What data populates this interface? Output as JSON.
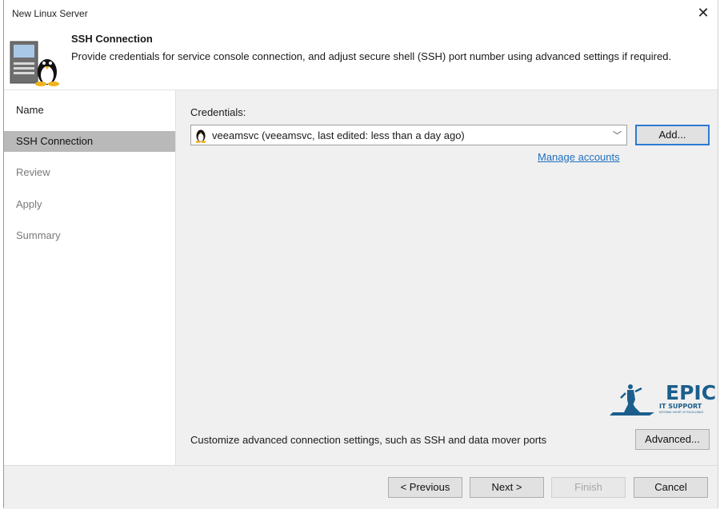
{
  "window": {
    "title": "New Linux Server"
  },
  "header": {
    "title": "SSH Connection",
    "description": "Provide credentials for service console connection, and adjust secure shell (SSH) port number using advanced settings if required."
  },
  "steps": [
    {
      "label": "Name",
      "state": "done"
    },
    {
      "label": "SSH Connection",
      "state": "active"
    },
    {
      "label": "Review",
      "state": "future"
    },
    {
      "label": "Apply",
      "state": "future"
    },
    {
      "label": "Summary",
      "state": "future"
    }
  ],
  "credentials": {
    "label": "Credentials:",
    "selected": "veeamsvc (veeamsvc, last edited: less than a day ago)",
    "add_label": "Add...",
    "manage_link": "Manage accounts"
  },
  "advanced": {
    "text": "Customize advanced connection settings, such as SSH and data mover ports",
    "button_label": "Advanced..."
  },
  "logo": {
    "text": "EPIC",
    "subtext": "IT SUPPORT",
    "tagline": "NOTHING SHORT OF EXCELLENCE",
    "color": "#1b5e8c"
  },
  "footer": {
    "previous_label": "< Previous",
    "next_label": "Next >",
    "finish_label": "Finish",
    "cancel_label": "Cancel"
  }
}
